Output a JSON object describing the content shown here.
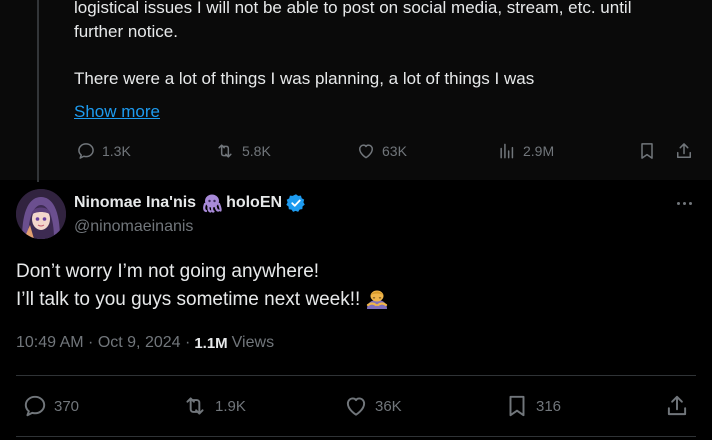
{
  "parent_post": {
    "text_line1": "logistical issues I will not be able to post on social media, stream, etc. until",
    "text_line2": "further notice.",
    "text_line3": "There were a lot of things I was planning, a lot of things I was",
    "show_more": "Show more",
    "actions": {
      "replies": "1.3K",
      "reposts": "5.8K",
      "likes": "63K",
      "views": "2.9M"
    }
  },
  "post": {
    "author": {
      "display_name": "Ninomae Ina'nis",
      "affiliation": "holoEN",
      "handle": "@ninomaeinanis",
      "verified": true
    },
    "text_line1": "Don’t worry I’m not going anywhere!",
    "text_line2": "I’ll talk to you guys sometime next week!!",
    "emoji": "person-bowing",
    "timestamp": "10:49 AM · Oct 9, 2024 ·",
    "views_count": "1.1M",
    "views_label": "Views",
    "actions": {
      "replies": "370",
      "reposts": "1.9K",
      "likes": "36K",
      "bookmarks": "316"
    }
  },
  "colors": {
    "background": "#000000",
    "text": "#e7e9ea",
    "secondary": "#71767b",
    "link": "#1d9bf0",
    "verified": "#1d9bf0",
    "divider": "#2f3336"
  }
}
